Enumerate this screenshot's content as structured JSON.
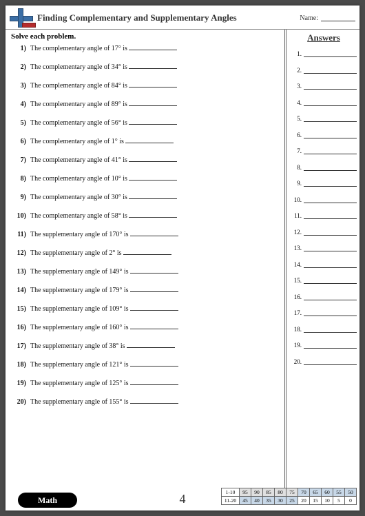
{
  "header": {
    "title": "Finding Complementary and Supplementary Angles",
    "name_label": "Name:"
  },
  "instruction": "Solve each problem.",
  "problems": [
    {
      "n": "1)",
      "text": "The complementary angle of 17° is"
    },
    {
      "n": "2)",
      "text": "The complementary angle of 34° is"
    },
    {
      "n": "3)",
      "text": "The complementary angle of 84° is"
    },
    {
      "n": "4)",
      "text": "The complementary angle of 89° is"
    },
    {
      "n": "5)",
      "text": "The complementary angle of 56° is"
    },
    {
      "n": "6)",
      "text": "The complementary angle of 1° is"
    },
    {
      "n": "7)",
      "text": "The complementary angle of 41° is"
    },
    {
      "n": "8)",
      "text": "The complementary angle of 10° is"
    },
    {
      "n": "9)",
      "text": "The complementary angle of 30° is"
    },
    {
      "n": "10)",
      "text": "The complementary angle of 58° is"
    },
    {
      "n": "11)",
      "text": "The supplementary angle of 170° is"
    },
    {
      "n": "12)",
      "text": "The supplementary angle of 2° is"
    },
    {
      "n": "13)",
      "text": "The supplementary angle of 149° is"
    },
    {
      "n": "14)",
      "text": "The supplementary angle of 179° is"
    },
    {
      "n": "15)",
      "text": "The supplementary angle of 109° is"
    },
    {
      "n": "16)",
      "text": "The supplementary angle of 160° is"
    },
    {
      "n": "17)",
      "text": "The supplementary angle of 38° is"
    },
    {
      "n": "18)",
      "text": "The supplementary angle of 121° is"
    },
    {
      "n": "19)",
      "text": "The supplementary angle of 125° is"
    },
    {
      "n": "20)",
      "text": "The supplementary angle of 155° is"
    }
  ],
  "answers_title": "Answers",
  "answer_numbers": [
    "1.",
    "2.",
    "3.",
    "4.",
    "5.",
    "6.",
    "7.",
    "8.",
    "9.",
    "10.",
    "11.",
    "12.",
    "13.",
    "14.",
    "15.",
    "16.",
    "17.",
    "18.",
    "19.",
    "20."
  ],
  "footer": {
    "math_label": "Math",
    "page_number": "4",
    "score": {
      "row1_label": "1-10",
      "row2_label": "11-20",
      "row1": [
        "95",
        "90",
        "85",
        "80",
        "75",
        "70",
        "65",
        "60",
        "55",
        "50"
      ],
      "row2": [
        "45",
        "40",
        "35",
        "30",
        "25",
        "20",
        "15",
        "10",
        "5",
        "0"
      ]
    }
  }
}
